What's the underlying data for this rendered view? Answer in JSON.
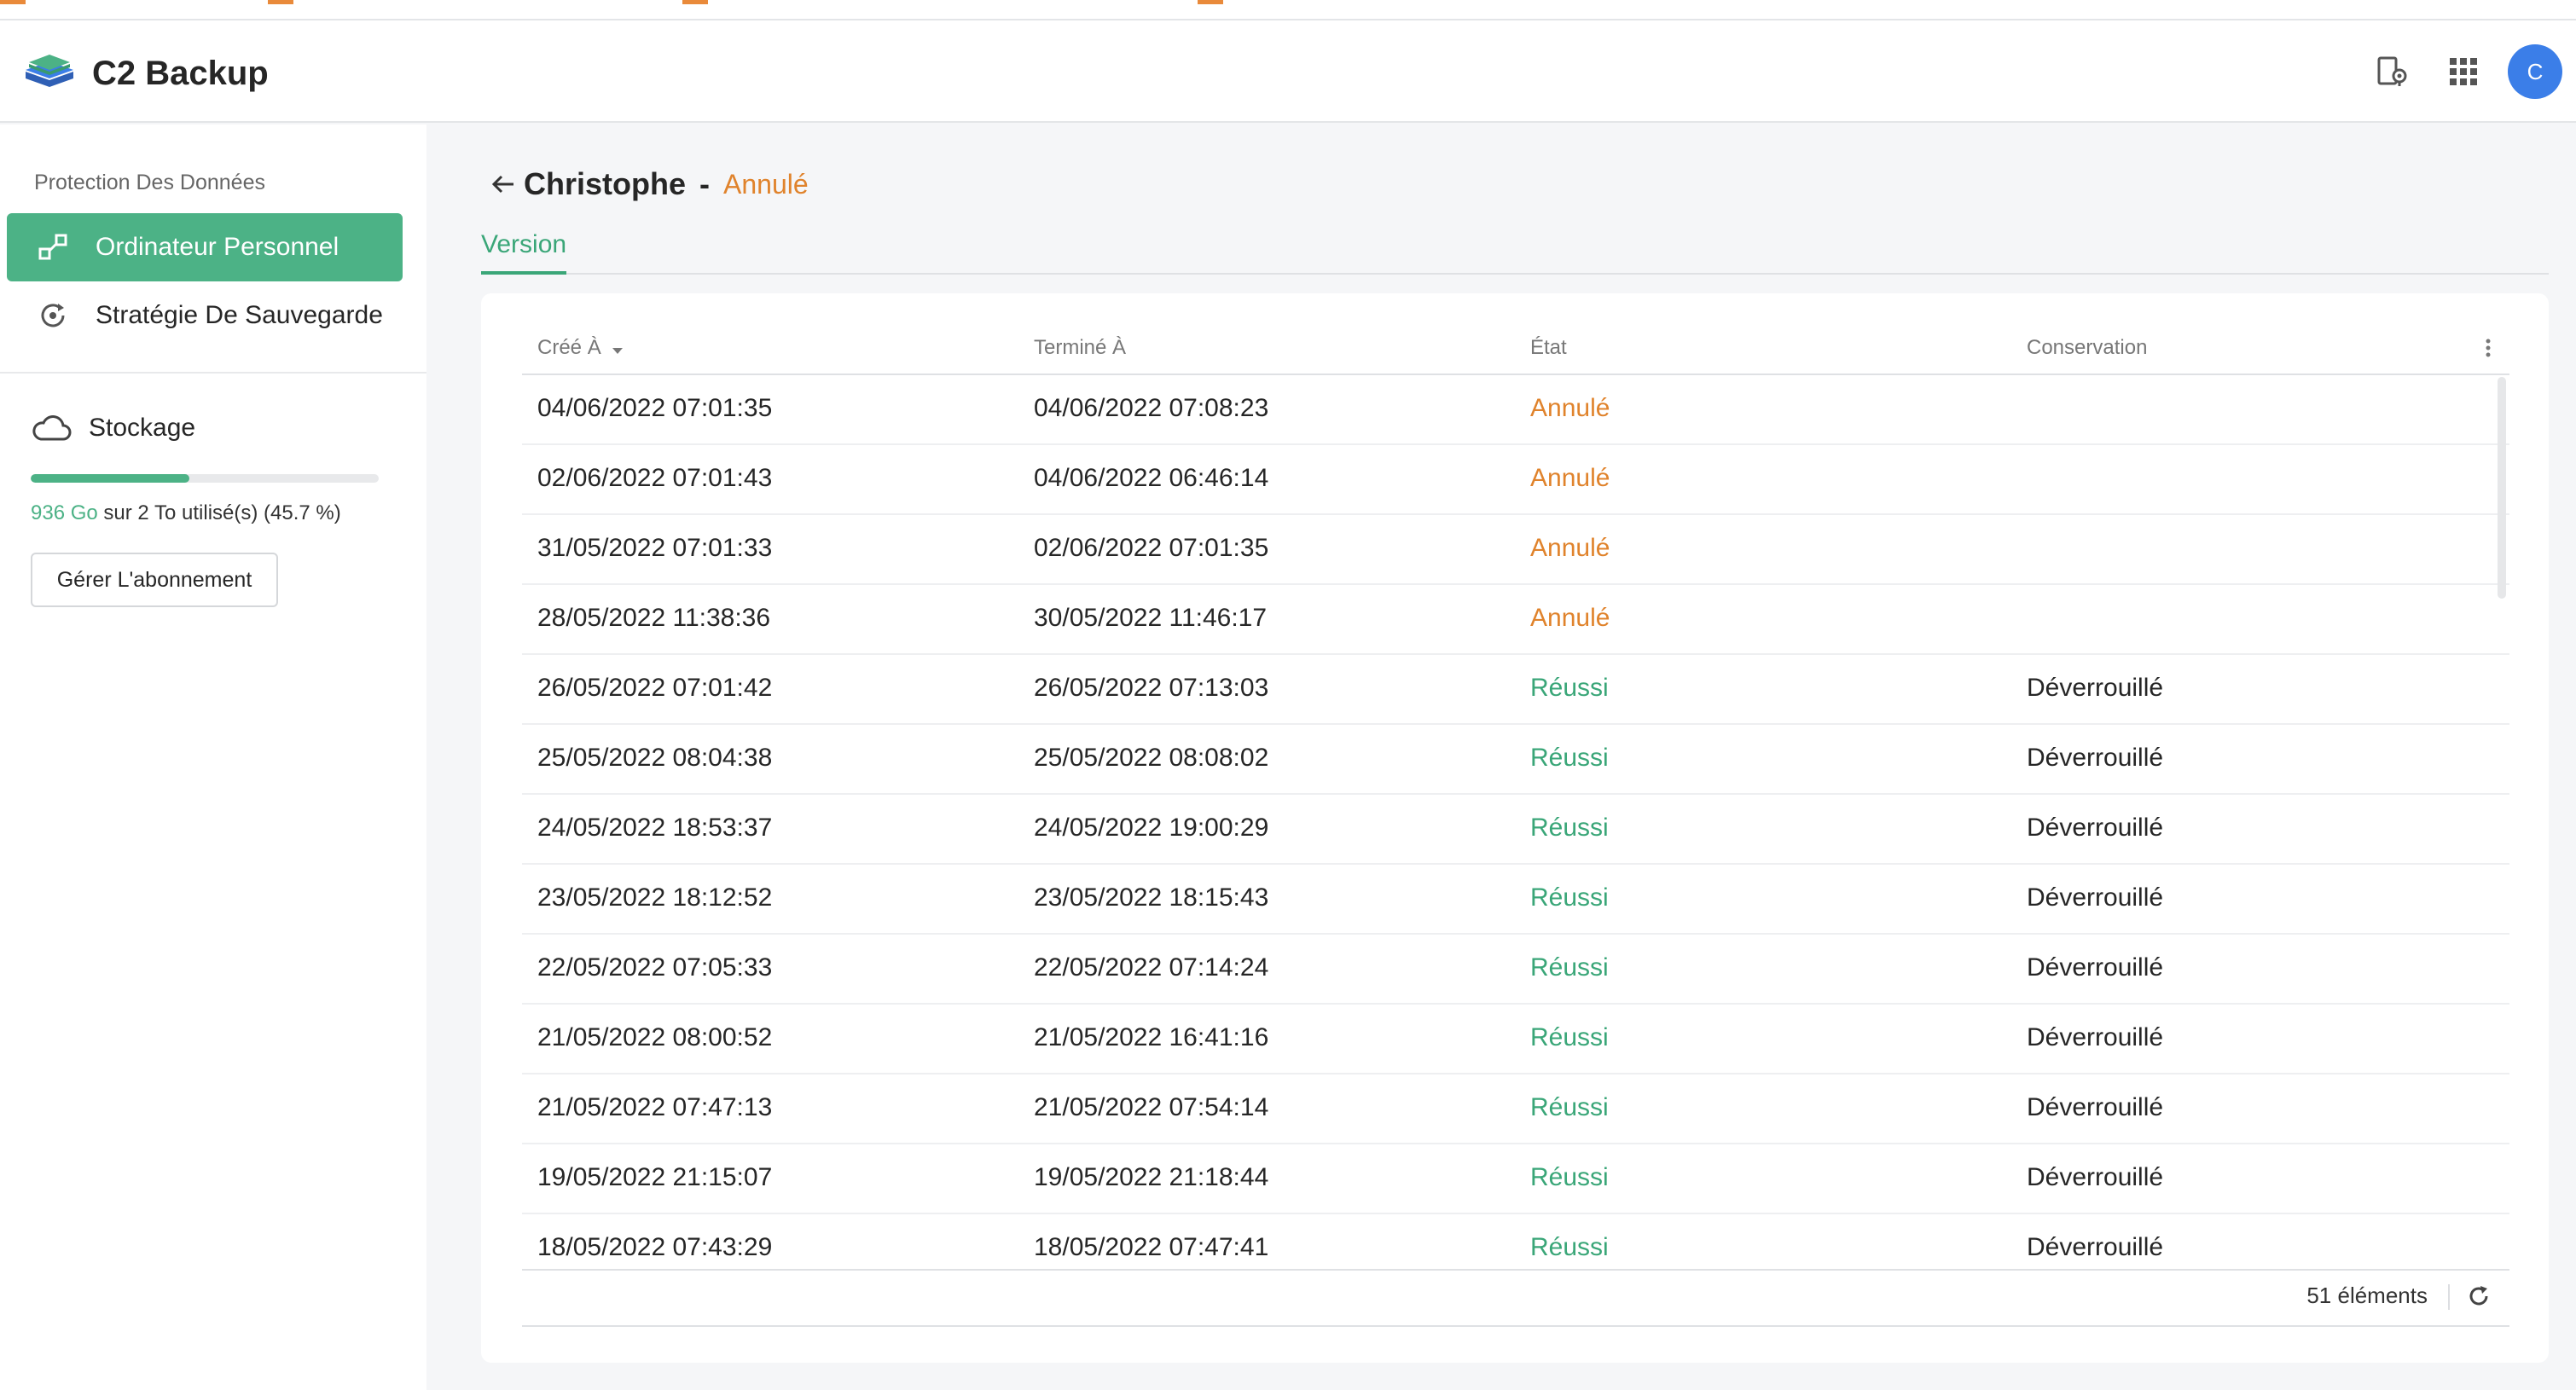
{
  "app": {
    "title": "C2 Backup",
    "avatar_letter": "C"
  },
  "colors": {
    "accent": "#4cb286",
    "cancelled": "#e0832c",
    "success": "#3aa678",
    "avatar": "#3b7ee8"
  },
  "header": {
    "icons": [
      "device-location-icon",
      "apps-grid-icon"
    ]
  },
  "sidebar": {
    "section_title": "Protection Des Données",
    "items": [
      {
        "label": "Ordinateur Personnel",
        "icon": "computer-link-icon",
        "active": true
      },
      {
        "label": "Stratégie De Sauvegarde",
        "icon": "backup-strategy-icon",
        "active": false
      }
    ],
    "storage": {
      "label": "Stockage",
      "used": "936 Go",
      "rest": " sur 2 To utilisé(s) (45.7 %)",
      "percent": 45.7,
      "button": "Gérer L'abonnement"
    }
  },
  "main": {
    "breadcrumb": {
      "name": "Christophe",
      "separator": "-",
      "status": "Annulé"
    },
    "tabs": [
      {
        "label": "Version"
      }
    ],
    "table": {
      "columns": [
        "Créé À",
        "Terminé À",
        "État",
        "Conservation"
      ],
      "rows": [
        [
          "04/06/2022 07:01:35",
          "04/06/2022 07:08:23",
          "Annulé",
          ""
        ],
        [
          "02/06/2022 07:01:43",
          "04/06/2022 06:46:14",
          "Annulé",
          ""
        ],
        [
          "31/05/2022 07:01:33",
          "02/06/2022 07:01:35",
          "Annulé",
          ""
        ],
        [
          "28/05/2022 11:38:36",
          "30/05/2022 11:46:17",
          "Annulé",
          ""
        ],
        [
          "26/05/2022 07:01:42",
          "26/05/2022 07:13:03",
          "Réussi",
          "Déverrouillé"
        ],
        [
          "25/05/2022 08:04:38",
          "25/05/2022 08:08:02",
          "Réussi",
          "Déverrouillé"
        ],
        [
          "24/05/2022 18:53:37",
          "24/05/2022 19:00:29",
          "Réussi",
          "Déverrouillé"
        ],
        [
          "23/05/2022 18:12:52",
          "23/05/2022 18:15:43",
          "Réussi",
          "Déverrouillé"
        ],
        [
          "22/05/2022 07:05:33",
          "22/05/2022 07:14:24",
          "Réussi",
          "Déverrouillé"
        ],
        [
          "21/05/2022 08:00:52",
          "21/05/2022 16:41:16",
          "Réussi",
          "Déverrouillé"
        ],
        [
          "21/05/2022 07:47:13",
          "21/05/2022 07:54:14",
          "Réussi",
          "Déverrouillé"
        ],
        [
          "19/05/2022 21:15:07",
          "19/05/2022 21:18:44",
          "Réussi",
          "Déverrouillé"
        ],
        [
          "18/05/2022 07:43:29",
          "18/05/2022 07:47:41",
          "Réussi",
          "Déverrouillé"
        ]
      ],
      "footer_count": "51 éléments"
    }
  }
}
